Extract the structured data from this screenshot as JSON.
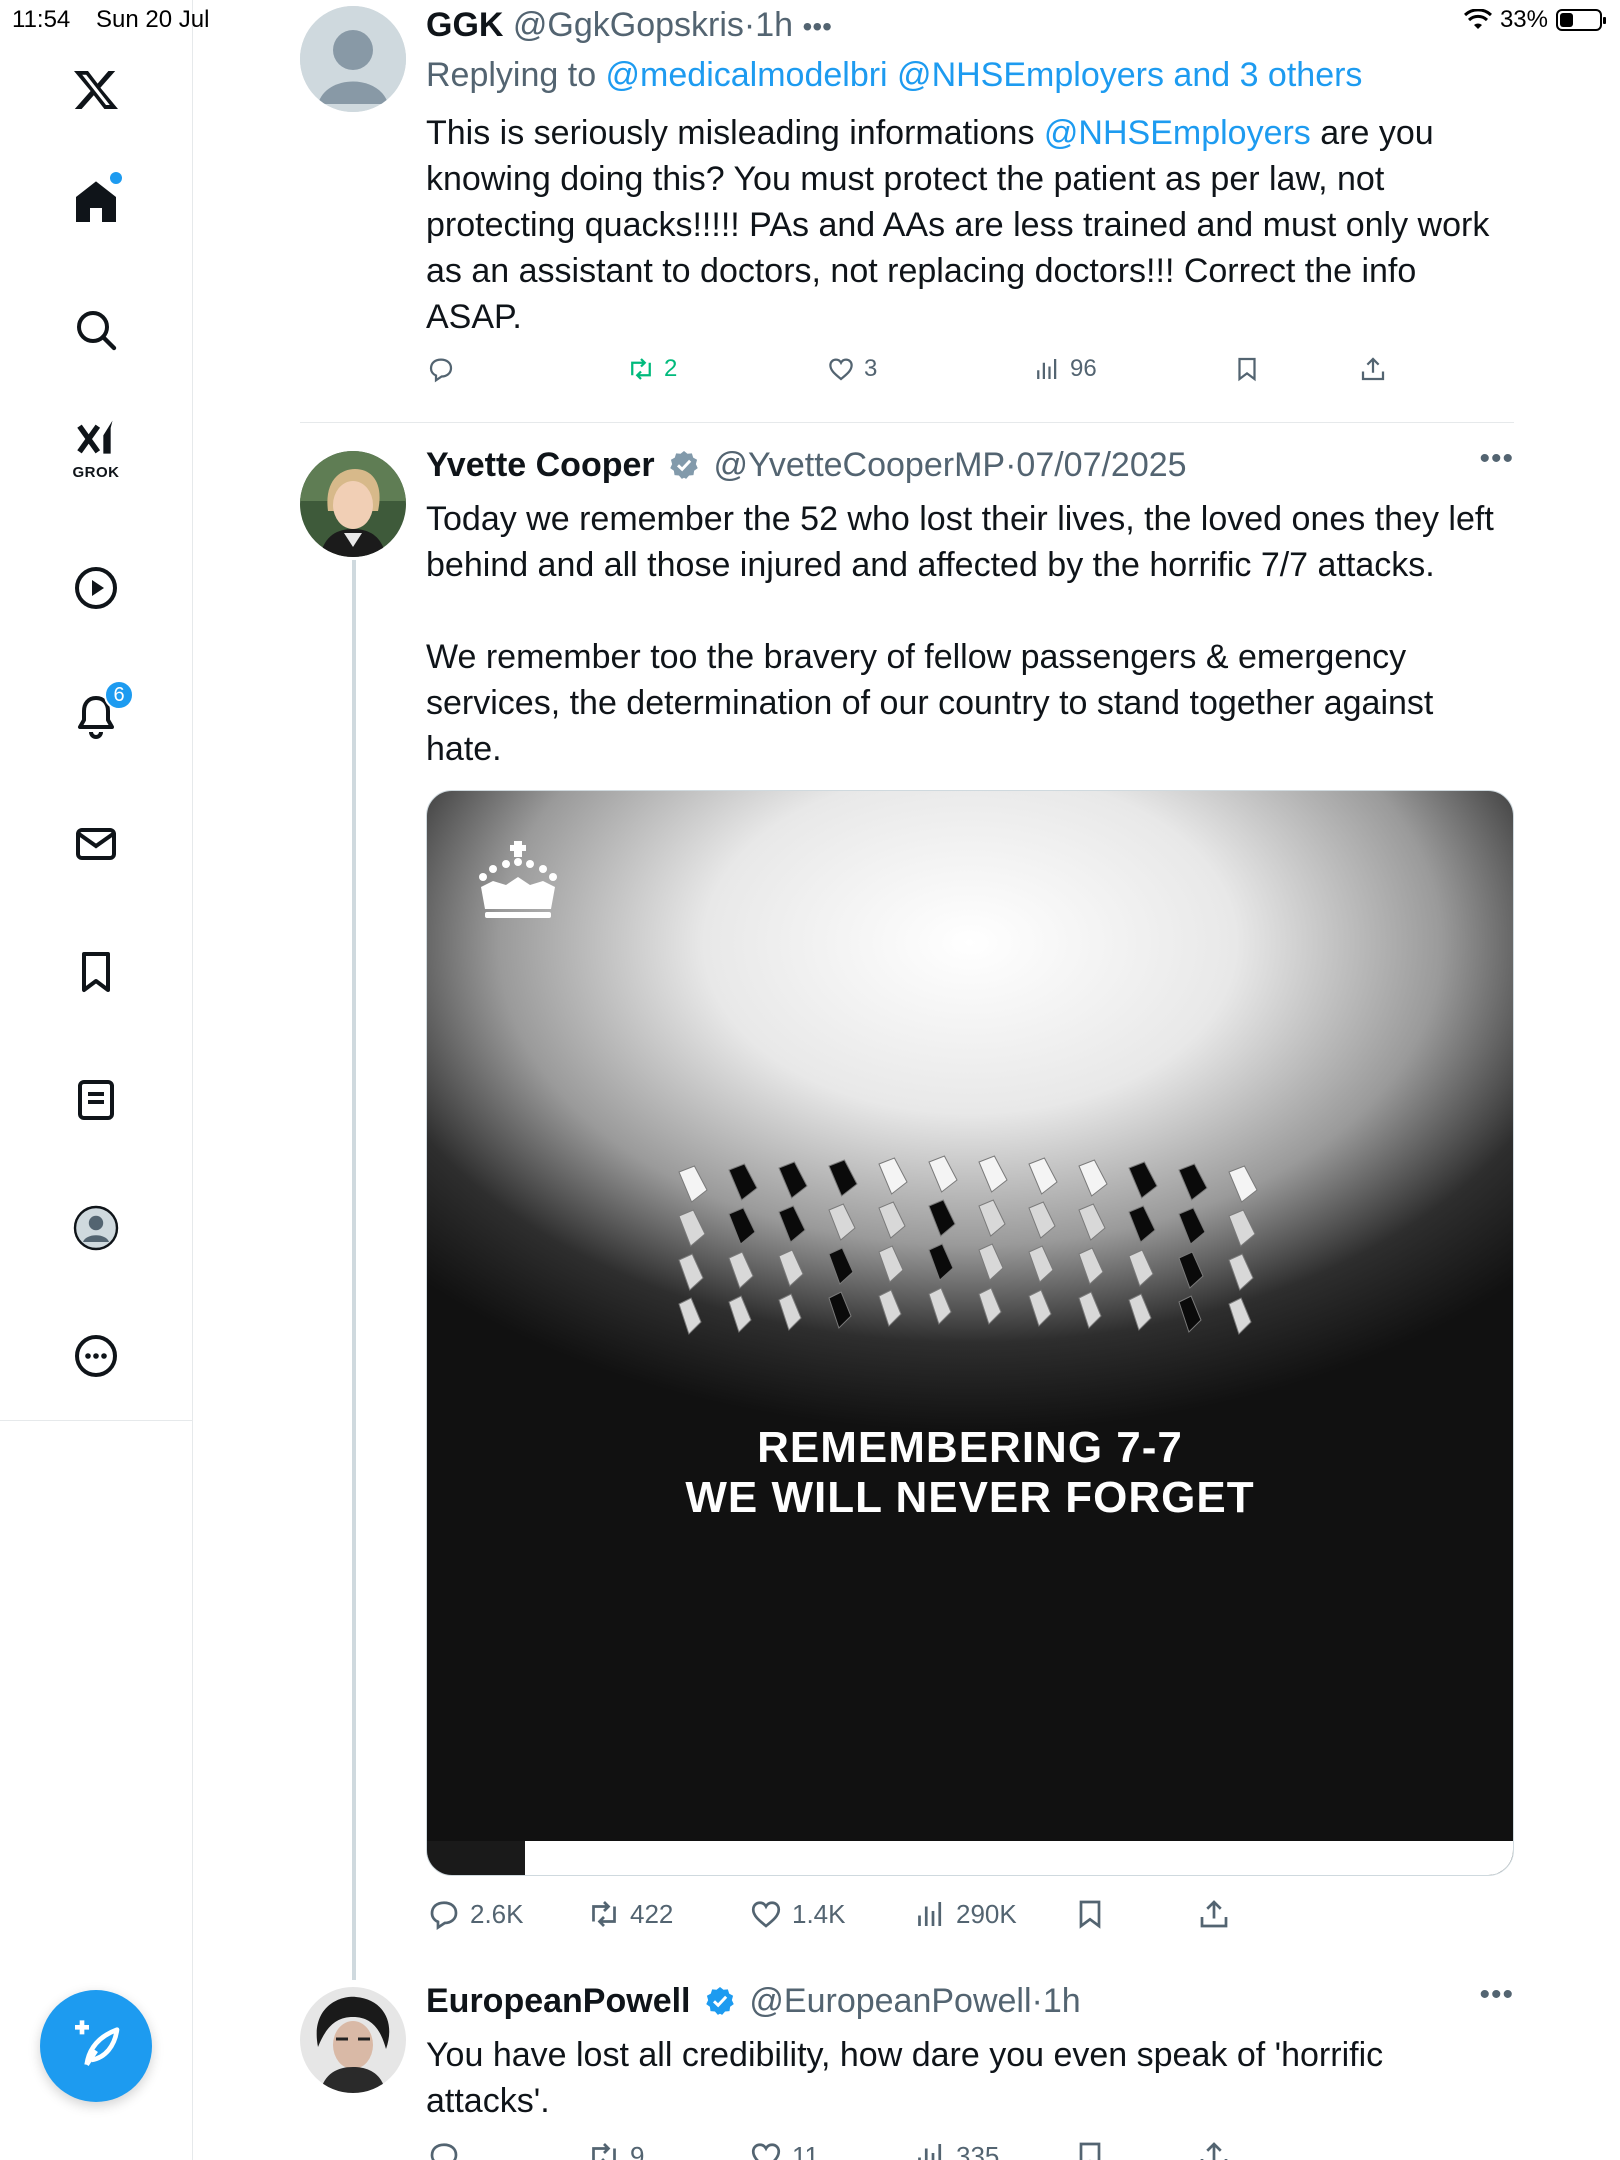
{
  "status_bar": {
    "time": "11:54",
    "date": "Sun 20 Jul",
    "battery": "33%",
    "battery_level": 0.33
  },
  "sidebar": {
    "items": [
      {
        "icon": "x-logo-icon"
      },
      {
        "icon": "home-icon",
        "has_dot": true
      },
      {
        "icon": "search-icon"
      },
      {
        "icon": "grok-icon",
        "label": "GROK"
      },
      {
        "icon": "video-icon"
      },
      {
        "icon": "bell-icon",
        "badge": "6"
      },
      {
        "icon": "mail-icon"
      },
      {
        "icon": "bookmark-icon"
      },
      {
        "icon": "list-icon"
      },
      {
        "icon": "profile-icon"
      },
      {
        "icon": "more-icon"
      }
    ],
    "compose_icon": "compose-icon"
  },
  "tweets": [
    {
      "name": "GGK",
      "handle": "@GgkGopskris",
      "sep": "·",
      "time": "1h",
      "replying_to_prefix": "Replying to ",
      "replying_to": "@medicalmodelbri @NHSEmployers and 3 others",
      "text_lines": [
        {
          "before": "This is seriously misleading informations ",
          "mention": "@NHSEmployers",
          "after": " are you"
        },
        "knowing doing this? You must protect the patient as per law, not",
        "protecting quacks!!!!! PAs and AAs are less trained and must only work",
        "as an assistant to doctors, not replacing doctors!!! Correct the info",
        "ASAP."
      ],
      "replies": "",
      "reposts": "2",
      "likes": "3",
      "views": "96"
    },
    {
      "name": "Yvette Cooper",
      "handle": "@YvetteCooperMP",
      "sep": "·",
      "time": "07/07/2025",
      "text_lines": [
        "Today we remember the 52 who lost their lives, the loved ones they left",
        "behind and all those injured and affected by the horrific 7/7 attacks.",
        "",
        "We remember too the bravery of fellow passengers & emergency",
        "services, the determination of our country to stand together against",
        "hate."
      ],
      "media_caption_1": "REMEMBERING 7-7",
      "media_caption_2": "WE WILL NEVER FORGET",
      "media_progress": 0.09,
      "replies": "2.6K",
      "reposts": "422",
      "likes": "1.4K",
      "views": "290K"
    },
    {
      "name": "EuropeanPowell",
      "handle": "@EuropeanPowell",
      "sep": "·",
      "time": "1h",
      "text_lines": [
        "You have lost all credibility, how dare you even speak of 'horrific",
        "attacks'."
      ],
      "replies": "",
      "reposts": "9",
      "likes": "11",
      "views": "335"
    }
  ],
  "colors": {
    "accent": "#1d9bf0",
    "repost_active": "#00ba7c",
    "secondary_text": "#536471"
  }
}
